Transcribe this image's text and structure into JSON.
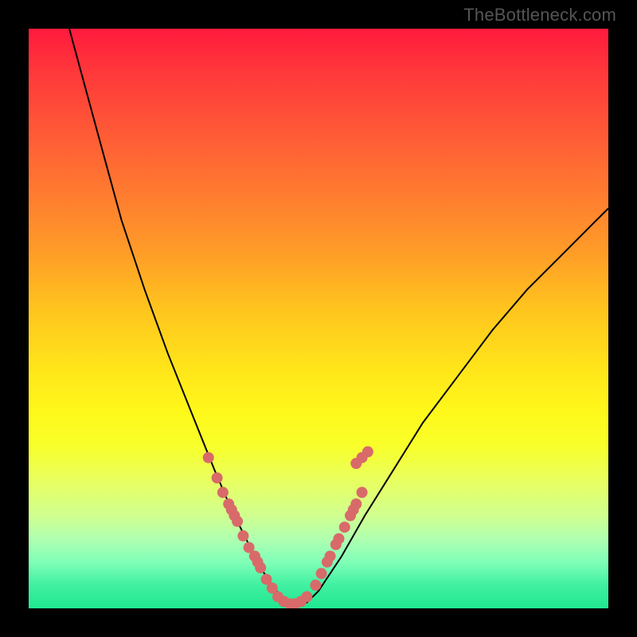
{
  "watermark": "TheBottleneck.com",
  "chart_data": {
    "type": "line",
    "title": "",
    "xlabel": "",
    "ylabel": "",
    "xlim": [
      0,
      100
    ],
    "ylim": [
      0,
      100
    ],
    "series": [
      {
        "name": "bottleneck-curve",
        "x": [
          7,
          10,
          13,
          16,
          20,
          24,
          28,
          32,
          35,
          38,
          40,
          42,
          43.5,
          45,
          46.5,
          48,
          50,
          54,
          58,
          63,
          68,
          74,
          80,
          86,
          92,
          98,
          100
        ],
        "y": [
          100,
          89,
          78,
          67,
          55,
          44,
          34,
          24,
          17,
          11,
          7,
          4,
          2,
          1,
          0.5,
          1,
          3,
          9,
          16,
          24,
          32,
          40,
          48,
          55,
          61,
          67,
          69
        ]
      }
    ],
    "markers": {
      "name": "highlight-points",
      "color": "#d86a6a",
      "points_x": [
        31,
        32.5,
        33.5,
        34.5,
        35,
        35.5,
        36,
        37,
        38,
        39,
        39.5,
        40,
        41,
        42,
        43,
        44,
        45,
        46,
        47,
        48,
        49.5,
        50.5,
        51.5,
        52,
        53,
        53.5,
        54.5,
        55.5,
        56,
        56.5,
        57.5
      ],
      "points_y": [
        26,
        22.5,
        20,
        18,
        17,
        16,
        15,
        12.5,
        10.5,
        9,
        8,
        7,
        5,
        3.5,
        2,
        1.2,
        0.8,
        0.8,
        1.2,
        2,
        4,
        6,
        8,
        9,
        11,
        12,
        14,
        16,
        17,
        18,
        20
      ]
    },
    "extra_markers": {
      "points_x": [
        56.5,
        57.5,
        58.5
      ],
      "points_y": [
        25,
        26,
        27
      ]
    }
  }
}
